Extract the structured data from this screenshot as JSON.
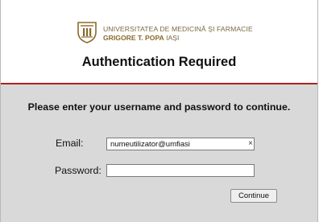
{
  "header": {
    "logo_line1": "UNIVERSITATEA DE MEDICINĂ ȘI FARMACIE",
    "logo_line2_bold": "GRIGORE T. POPA",
    "logo_line2_rest": " IAȘI",
    "title": "Authentication Required"
  },
  "form": {
    "prompt": "Please enter your username and password to continue.",
    "email_label": "Email:",
    "email_value": "numeutilizator@umfiasi",
    "password_label": "Password:",
    "password_value": "",
    "clear_glyph": "×",
    "continue_label": "Continue"
  },
  "colors": {
    "panel_bg": "#d9d9d9",
    "accent_border": "#b02020",
    "logo_gold": "#7a6840"
  },
  "icons": {
    "logo": "university-crest-icon",
    "clear": "clear-field-icon"
  }
}
